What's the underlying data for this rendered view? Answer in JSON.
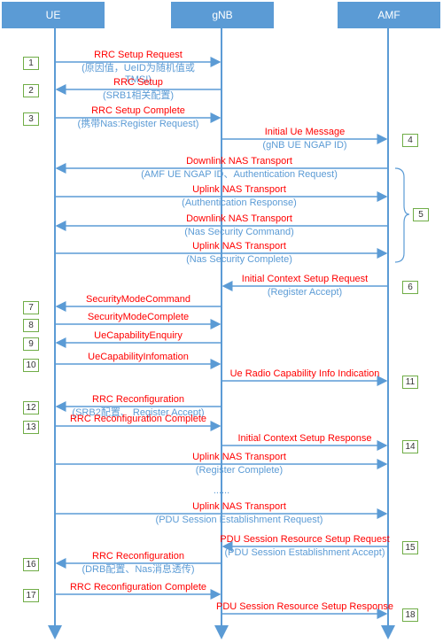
{
  "entities": [
    {
      "id": "ue",
      "label": "UE"
    },
    {
      "id": "gnb",
      "label": "gNB"
    },
    {
      "id": "amf",
      "label": "AMF"
    }
  ],
  "messages": [
    {
      "from": "ue",
      "to": "gnb",
      "title": "RRC Setup Request",
      "detail": "(原因值，UeID为随机值或\nTMSI)",
      "step": "1"
    },
    {
      "from": "gnb",
      "to": "ue",
      "title": "RRC Setup",
      "detail": "(SRB1相关配置)",
      "step": "2"
    },
    {
      "from": "ue",
      "to": "gnb",
      "title": "RRC Setup Complete",
      "detail": "(携带Nas:Register Request)",
      "step": "3"
    },
    {
      "from": "gnb",
      "to": "amf",
      "title": "Initial Ue Message",
      "detail": "(gNB UE NGAP ID)",
      "step": "4"
    },
    {
      "from": "amf",
      "to": "ue",
      "title": "Downlink NAS Transport",
      "detail": "(AMF UE NGAP ID、Authentication Request)",
      "step": ""
    },
    {
      "from": "ue",
      "to": "amf",
      "title": "Uplink NAS Transport",
      "detail": "(Authentication Response)",
      "step": ""
    },
    {
      "from": "amf",
      "to": "ue",
      "title": "Downlink NAS Transport",
      "detail": "(Nas Security Command)",
      "step": ""
    },
    {
      "from": "ue",
      "to": "amf",
      "title": "Uplink NAS Transport",
      "detail": "(Nas Security Complete)",
      "step": ""
    },
    {
      "from": "amf",
      "to": "gnb",
      "title": "Initial Context Setup Request",
      "detail": "(Register Accept)",
      "step": "6"
    },
    {
      "from": "gnb",
      "to": "ue",
      "title": "SecurityModeCommand",
      "detail": "",
      "step": "7"
    },
    {
      "from": "ue",
      "to": "gnb",
      "title": "SecurityModeComplete",
      "detail": "",
      "step": "8"
    },
    {
      "from": "gnb",
      "to": "ue",
      "title": "UeCapabilityEnquiry",
      "detail": "",
      "step": "9"
    },
    {
      "from": "ue",
      "to": "gnb",
      "title": "UeCapabilityInfomation",
      "detail": "",
      "step": "10"
    },
    {
      "from": "gnb",
      "to": "amf",
      "title": "Ue Radio Capability Info Indication",
      "detail": "",
      "step": "11"
    },
    {
      "from": "gnb",
      "to": "ue",
      "title": "RRC Reconfiguration",
      "detail": "(SRB2配置、 Register Accept)",
      "step": "12"
    },
    {
      "from": "ue",
      "to": "gnb",
      "title": "RRC Reconfiguration Complete",
      "detail": "",
      "step": "13"
    },
    {
      "from": "gnb",
      "to": "amf",
      "title": "Initial Context Setup Response",
      "detail": "",
      "step": "14"
    },
    {
      "from": "ue",
      "to": "amf",
      "title": "Uplink NAS Transport",
      "detail": "(Register Complete)",
      "step": ""
    },
    {
      "from": "ue",
      "to": "amf",
      "title": "Uplink NAS Transport",
      "detail": "(PDU Session Establishment Request)",
      "step": ""
    },
    {
      "from": "amf",
      "to": "gnb",
      "title": "PDU Session Resource Setup Request",
      "detail": "(PDU Session Establishment Accept)",
      "step": "15"
    },
    {
      "from": "gnb",
      "to": "ue",
      "title": "RRC Reconfiguration",
      "detail": "(DRB配置、Nas消息透传)",
      "step": "16"
    },
    {
      "from": "ue",
      "to": "gnb",
      "title": "RRC Reconfiguration Complete",
      "detail": "",
      "step": "17"
    },
    {
      "from": "gnb",
      "to": "amf",
      "title": "PDU Session Resource Setup Response",
      "detail": "",
      "step": "18"
    }
  ],
  "group_step": "5",
  "ellipsis": "......",
  "colors": {
    "header": "#5b9bd5",
    "lifeline": "#5b9bd5",
    "title": "#ff0000",
    "detail": "#5b9bd5",
    "step_border": "#70ad47"
  }
}
